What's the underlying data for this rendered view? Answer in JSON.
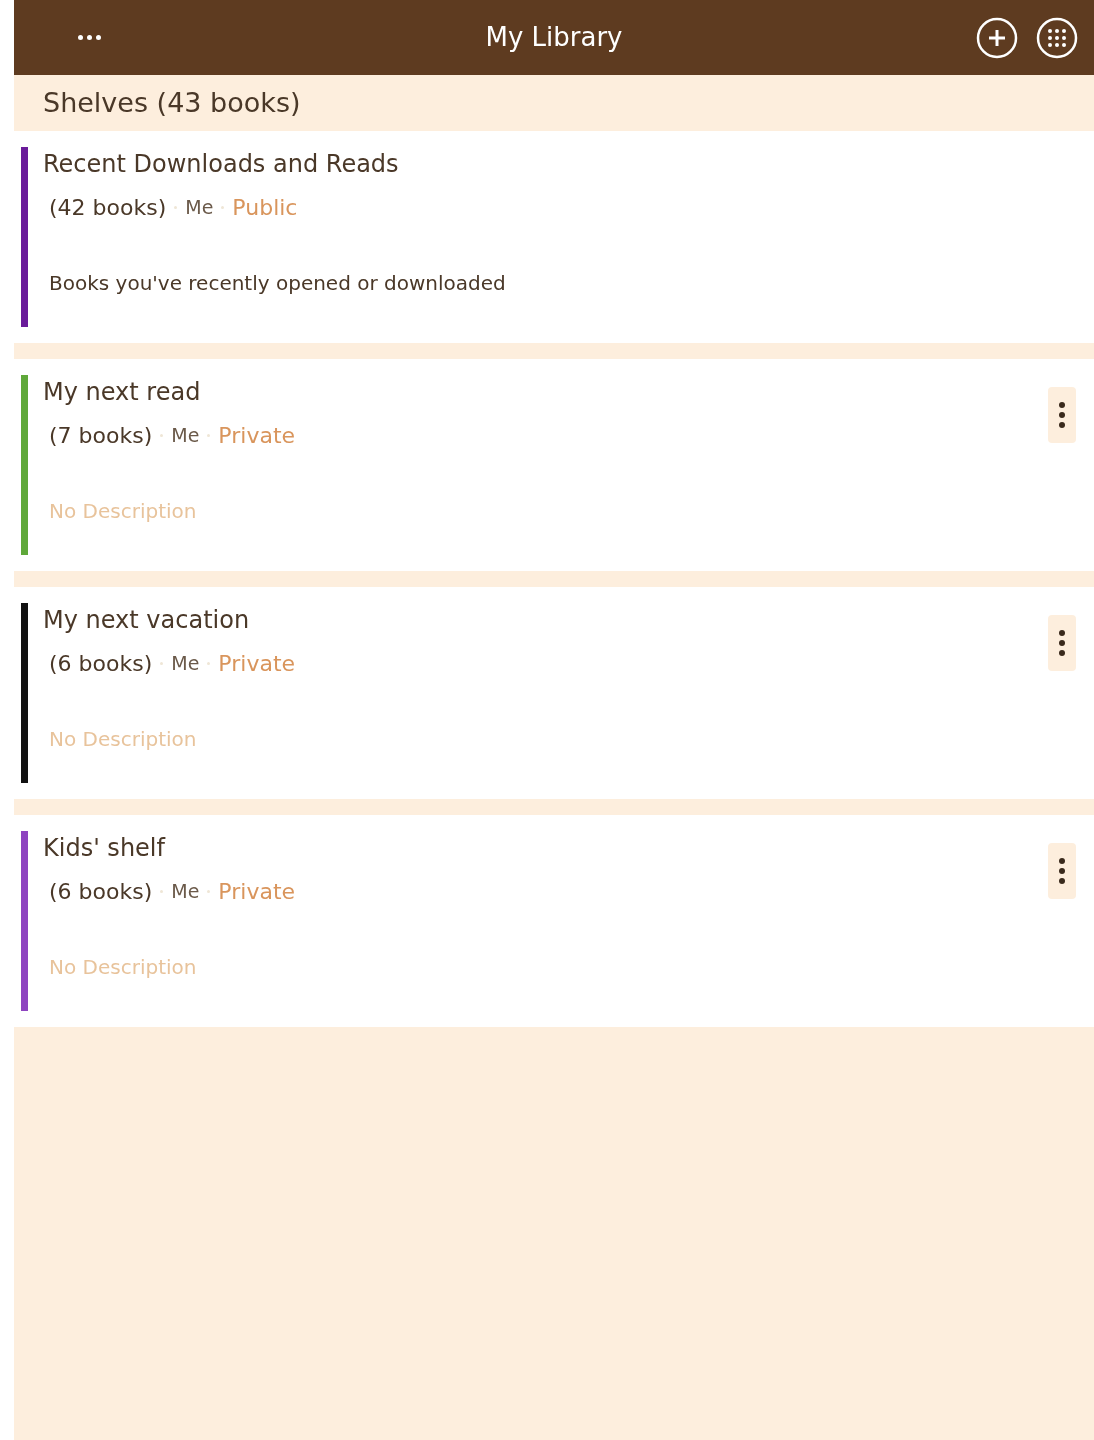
{
  "header": {
    "title": "My Library"
  },
  "section": {
    "title": "Shelves (43 books)"
  },
  "shelves": [
    {
      "name": "Recent Downloads and Reads",
      "count": "(42 books)",
      "owner": "Me",
      "visibility": "Public",
      "description": "Books you've recently opened or downloaded",
      "description_muted": false,
      "has_menu": false,
      "color": "#6a1b9a"
    },
    {
      "name": "My next read",
      "count": "(7 books)",
      "owner": "Me",
      "visibility": "Private",
      "description": "No Description",
      "description_muted": true,
      "has_menu": true,
      "color": "#5fa83a"
    },
    {
      "name": "My next vacation",
      "count": "(6 books)",
      "owner": "Me",
      "visibility": "Private",
      "description": "No Description",
      "description_muted": true,
      "has_menu": true,
      "color": "#111111"
    },
    {
      "name": "Kids' shelf",
      "count": "(6 books)",
      "owner": "Me",
      "visibility": "Private",
      "description": "No Description",
      "description_muted": true,
      "has_menu": true,
      "color": "#8e44c0"
    }
  ]
}
